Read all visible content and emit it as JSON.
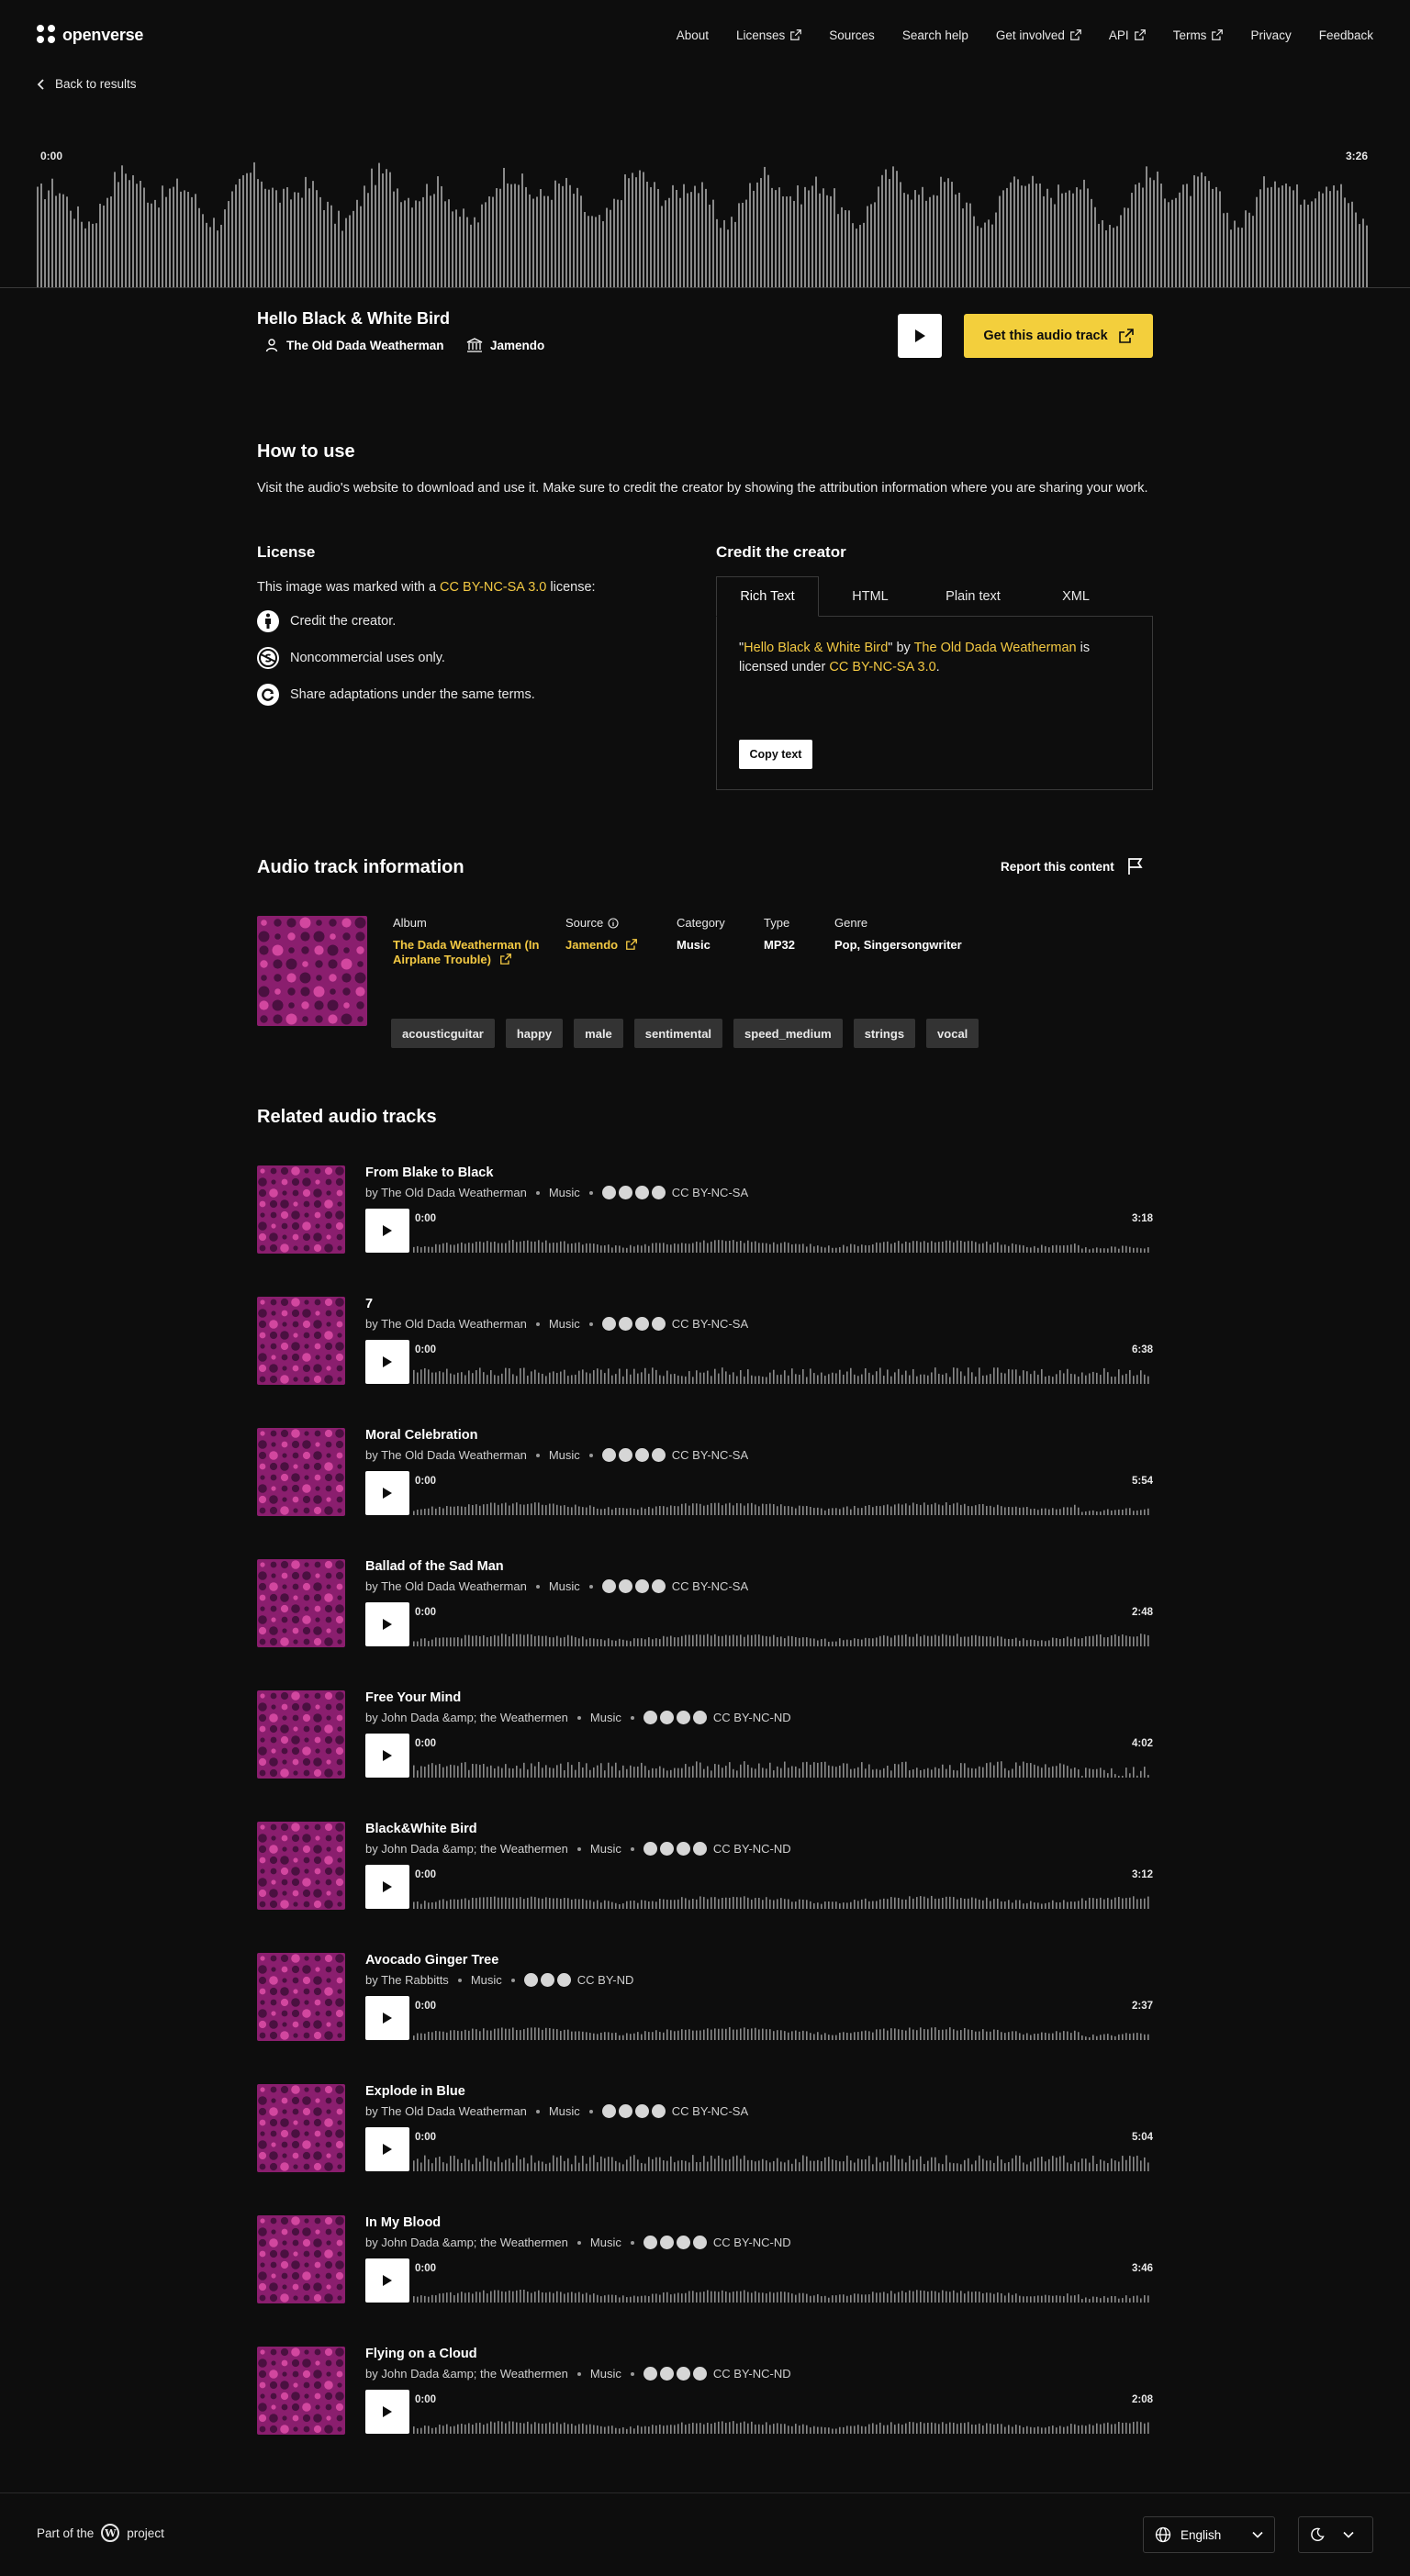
{
  "colors": {
    "background": "#0d0d0d",
    "accent": "#f3cf3c",
    "link": "#f3c943",
    "art": "#8a1e6e",
    "tag_bg": "#333333"
  },
  "header": {
    "logo": "openverse",
    "nav": [
      {
        "label": "About",
        "external": false
      },
      {
        "label": "Licenses",
        "external": true
      },
      {
        "label": "Sources",
        "external": false
      },
      {
        "label": "Search help",
        "external": false
      },
      {
        "label": "Get involved",
        "external": true
      },
      {
        "label": "API",
        "external": true
      },
      {
        "label": "Terms",
        "external": true
      },
      {
        "label": "Privacy",
        "external": false
      },
      {
        "label": "Feedback",
        "external": false
      }
    ]
  },
  "back_link": "Back to results",
  "player": {
    "time_start": "0:00",
    "time_end": "3:26"
  },
  "track": {
    "title": "Hello Black & White Bird",
    "creator": "The Old Dada Weatherman",
    "source": "Jamendo",
    "get_button": "Get this audio track"
  },
  "how_to_use": {
    "heading": "How to use",
    "text": "Visit the audio's website to download and use it. Make sure to credit the creator by showing the attribution information where you are sharing your work."
  },
  "license": {
    "heading": "License",
    "pre": "This image was marked with a ",
    "name": "CC BY-NC-SA 3.0",
    "post": " license:",
    "items": [
      {
        "icon": "cc-by-icon",
        "text": "Credit the creator."
      },
      {
        "icon": "cc-nc-icon",
        "text": "Noncommercial uses only."
      },
      {
        "icon": "cc-sa-icon",
        "text": "Share adaptations under the same terms."
      }
    ]
  },
  "credit": {
    "heading": "Credit the creator",
    "tabs": [
      "Rich Text",
      "HTML",
      "Plain text",
      "XML"
    ],
    "active_tab": "Rich Text",
    "q1": "\"",
    "title": "Hello Black & White Bird",
    "q2": "\" by ",
    "creator": "The Old Dada Weatherman",
    "mid": " is licensed under ",
    "license": "CC BY-NC-SA 3.0",
    "end": ".",
    "copy_button": "Copy text"
  },
  "info": {
    "heading": "Audio track information",
    "report": "Report this content",
    "album_label": "Album",
    "album": "The Dada Weatherman (In Airplane Trouble)",
    "source_label": "Source",
    "source": "Jamendo",
    "category_label": "Category",
    "category": "Music",
    "type_label": "Type",
    "type": "MP32",
    "genre_label": "Genre",
    "genre": "Pop, Singersongwriter",
    "tags": [
      "acousticguitar",
      "happy",
      "male",
      "sentimental",
      "speed_medium",
      "strings",
      "vocal"
    ]
  },
  "related": {
    "heading": "Related audio tracks",
    "tracks": [
      {
        "title": "From Blake to Black",
        "by": "by The Old Dada Weatherman",
        "category": "Music",
        "license": "CC BY-NC-SA",
        "icons": [
          "cc",
          "by",
          "nc",
          "sa"
        ],
        "start": "0:00",
        "duration": "3:18"
      },
      {
        "title": "7",
        "by": "by The Old Dada Weatherman",
        "category": "Music",
        "license": "CC BY-NC-SA",
        "icons": [
          "cc",
          "by",
          "nc",
          "sa"
        ],
        "start": "0:00",
        "duration": "6:38"
      },
      {
        "title": "Moral Celebration",
        "by": "by The Old Dada Weatherman",
        "category": "Music",
        "license": "CC BY-NC-SA",
        "icons": [
          "cc",
          "by",
          "nc",
          "sa"
        ],
        "start": "0:00",
        "duration": "5:54"
      },
      {
        "title": "Ballad of the Sad Man",
        "by": "by The Old Dada Weatherman",
        "category": "Music",
        "license": "CC BY-NC-SA",
        "icons": [
          "cc",
          "by",
          "nc",
          "sa"
        ],
        "start": "0:00",
        "duration": "2:48"
      },
      {
        "title": "Free Your Mind",
        "by": "by John Dada &amp; the Weathermen",
        "category": "Music",
        "license": "CC BY-NC-ND",
        "icons": [
          "cc",
          "by",
          "nc",
          "nd"
        ],
        "start": "0:00",
        "duration": "4:02"
      },
      {
        "title": "Black&White Bird",
        "by": "by John Dada &amp; the Weathermen",
        "category": "Music",
        "license": "CC BY-NC-ND",
        "icons": [
          "cc",
          "by",
          "nc",
          "nd"
        ],
        "start": "0:00",
        "duration": "3:12"
      },
      {
        "title": "Avocado Ginger Tree",
        "by": "by The Rabbitts",
        "category": "Music",
        "license": "CC BY-ND",
        "icons": [
          "cc",
          "by",
          "nd"
        ],
        "start": "0:00",
        "duration": "2:37"
      },
      {
        "title": "Explode in Blue",
        "by": "by The Old Dada Weatherman",
        "category": "Music",
        "license": "CC BY-NC-SA",
        "icons": [
          "cc",
          "by",
          "nc",
          "sa"
        ],
        "start": "0:00",
        "duration": "5:04"
      },
      {
        "title": "In My Blood",
        "by": "by John Dada &amp; the Weathermen",
        "category": "Music",
        "license": "CC BY-NC-ND",
        "icons": [
          "cc",
          "by",
          "nc",
          "nd"
        ],
        "start": "0:00",
        "duration": "3:46"
      },
      {
        "title": "Flying on a Cloud",
        "by": "by John Dada &amp; the Weathermen",
        "category": "Music",
        "license": "CC BY-NC-ND",
        "icons": [
          "cc",
          "by",
          "nc",
          "nd"
        ],
        "start": "0:00",
        "duration": "2:08"
      }
    ]
  },
  "footer": {
    "part_of": "Part of the",
    "project": "project",
    "language": "English"
  }
}
